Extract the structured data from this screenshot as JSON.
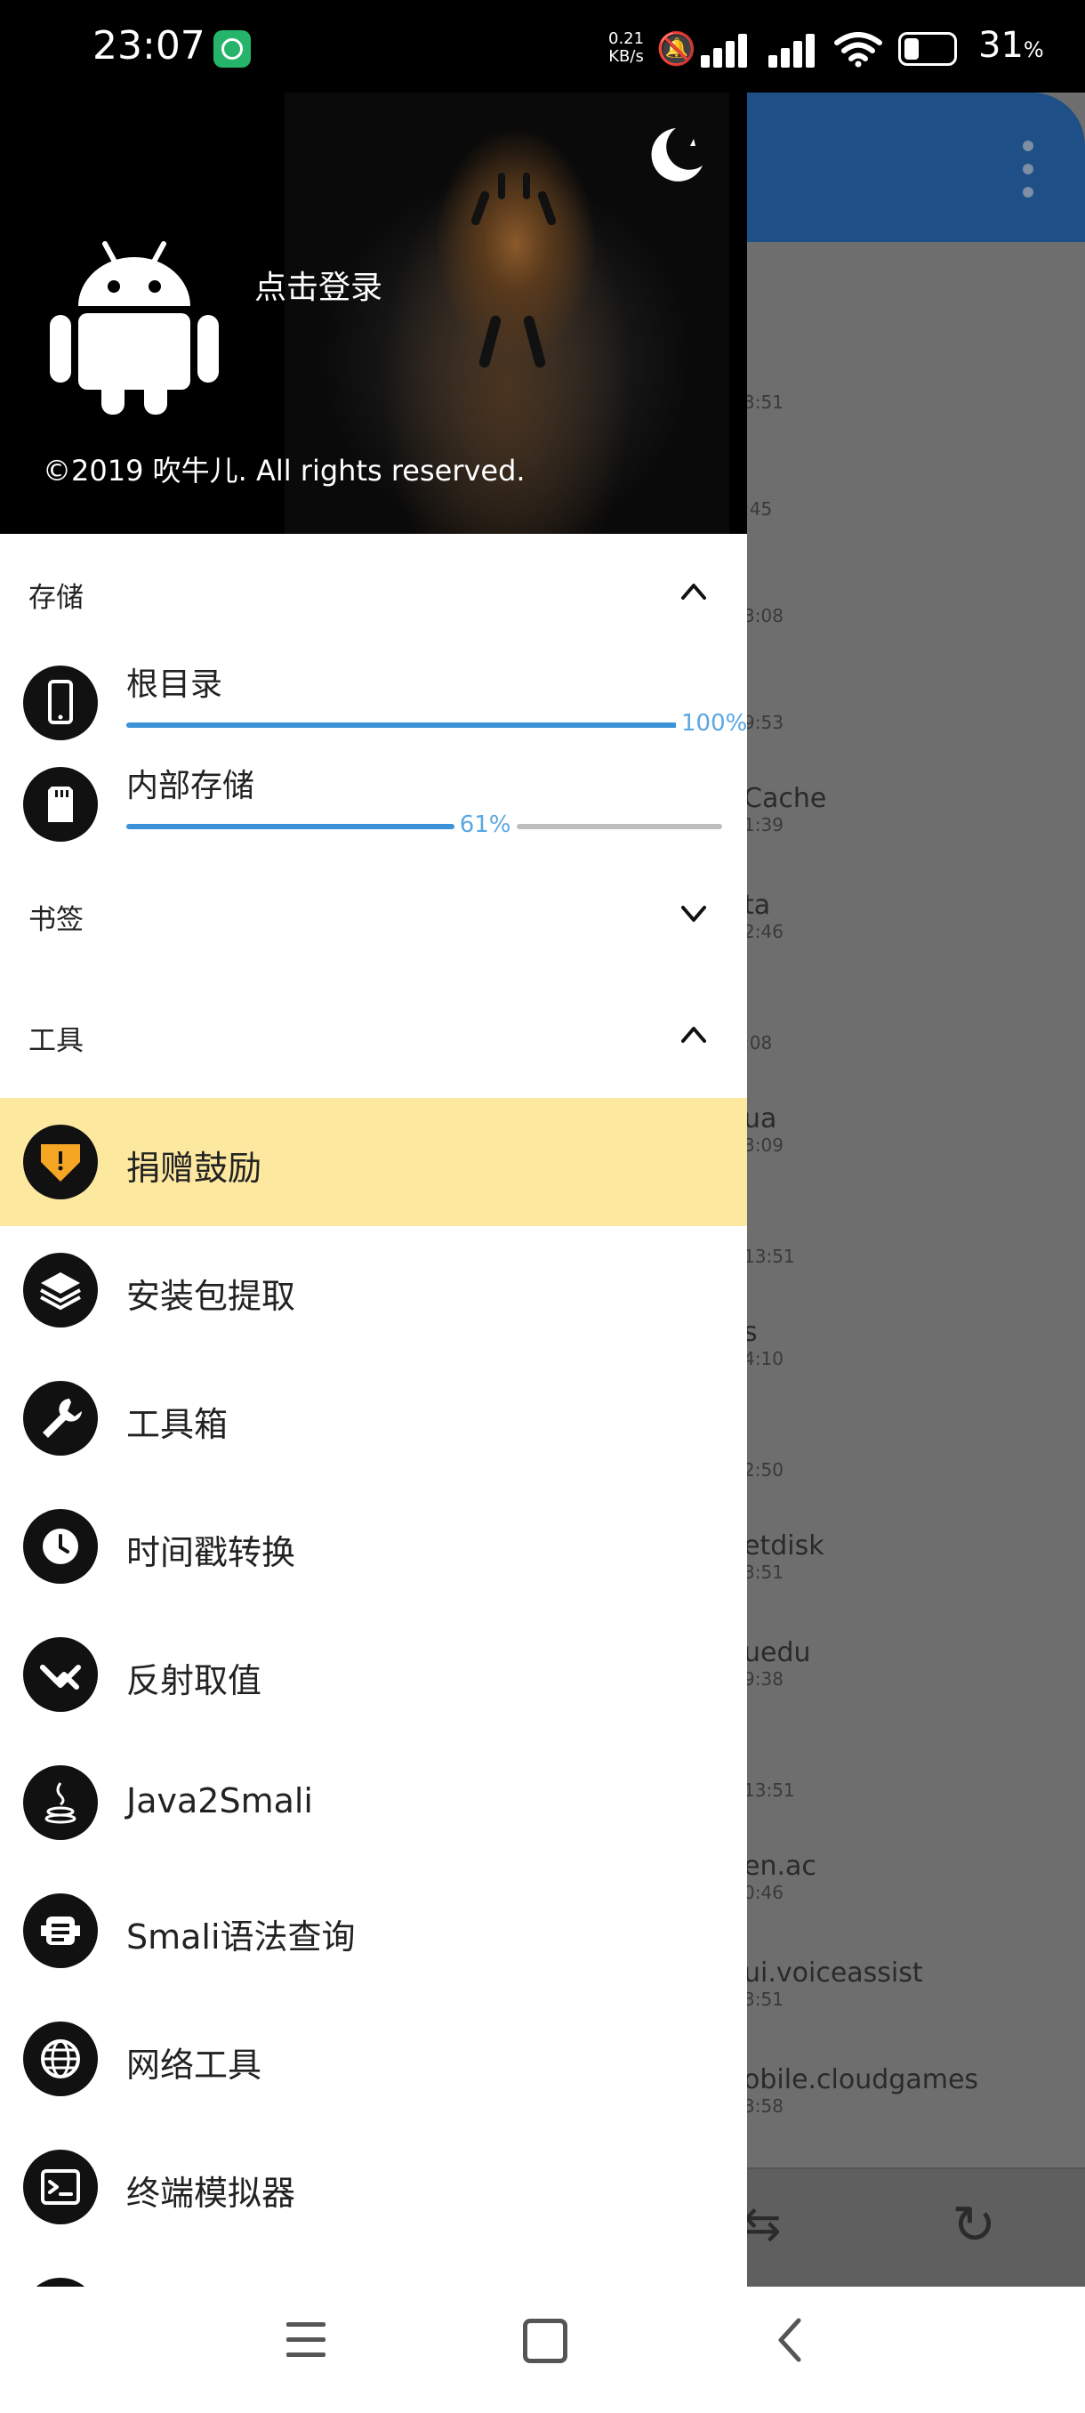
{
  "status_bar": {
    "time": "23:07",
    "speed_value": "0.21",
    "speed_unit": "KB/s",
    "battery_percent": "31",
    "battery_unit": "%"
  },
  "header": {
    "login_label": "点击登录",
    "copyright": "©2019 吹牛儿. All rights reserved."
  },
  "sections": {
    "storage_title": "存储",
    "bookmarks_title": "书签",
    "tools_title": "工具"
  },
  "storage_items": [
    {
      "name": "根目录",
      "percent_label": "100%",
      "usage": 1.0
    },
    {
      "name": "内部存储",
      "percent_label": "61%",
      "usage": 0.61
    }
  ],
  "tools": [
    {
      "label": "捐赠鼓励",
      "icon": "donate-icon"
    },
    {
      "label": "安装包提取",
      "icon": "layers-icon"
    },
    {
      "label": "工具箱",
      "icon": "wrench-icon"
    },
    {
      "label": "时间戳转换",
      "icon": "clock-icon"
    },
    {
      "label": "反射取值",
      "icon": "trend-icon"
    },
    {
      "label": "Java2Smali",
      "icon": "java-icon"
    },
    {
      "label": "Smali语法查询",
      "icon": "code-icon"
    },
    {
      "label": "网络工具",
      "icon": "globe-icon"
    },
    {
      "label": "终端模拟器",
      "icon": "terminal-icon"
    }
  ],
  "background_list": [
    {
      "name": "",
      "time": "3:51"
    },
    {
      "name": "",
      "time": ":45"
    },
    {
      "name": "",
      "time": "3:08"
    },
    {
      "name": "",
      "time": "9:53"
    },
    {
      "name": "Cache",
      "time": "1:39"
    },
    {
      "name": "ta",
      "time": "2:46"
    },
    {
      "name": "",
      "time": ":08"
    },
    {
      "name": "ua",
      "time": "3:09"
    },
    {
      "name": "",
      "time": "13:51"
    },
    {
      "name": "s",
      "time": "4:10"
    },
    {
      "name": "",
      "time": "2:50"
    },
    {
      "name": "etdisk",
      "time": "3:51"
    },
    {
      "name": "uedu",
      "time": "9:38"
    },
    {
      "name": "",
      "time": "13:51"
    },
    {
      "name": "en.ac",
      "time": "0:46"
    },
    {
      "name": "ui.voiceassist",
      "time": "3:51"
    },
    {
      "name": "obile.cloudgames",
      "time": "3:58"
    }
  ],
  "colors": {
    "accent_blue": "#3b92d8",
    "app_bar": "#1e4f86",
    "highlight": "#fde8a0",
    "donate_orange": "#f5a623"
  }
}
